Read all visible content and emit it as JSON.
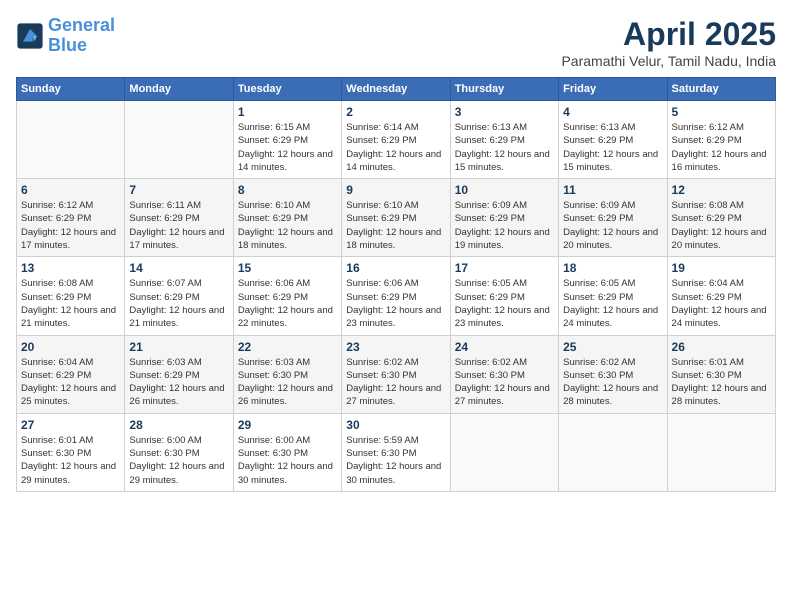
{
  "logo": {
    "line1": "General",
    "line2": "Blue"
  },
  "title": "April 2025",
  "subtitle": "Paramathi Velur, Tamil Nadu, India",
  "headers": [
    "Sunday",
    "Monday",
    "Tuesday",
    "Wednesday",
    "Thursday",
    "Friday",
    "Saturday"
  ],
  "weeks": [
    [
      {
        "day": "",
        "info": ""
      },
      {
        "day": "",
        "info": ""
      },
      {
        "day": "1",
        "info": "Sunrise: 6:15 AM\nSunset: 6:29 PM\nDaylight: 12 hours and 14 minutes."
      },
      {
        "day": "2",
        "info": "Sunrise: 6:14 AM\nSunset: 6:29 PM\nDaylight: 12 hours and 14 minutes."
      },
      {
        "day": "3",
        "info": "Sunrise: 6:13 AM\nSunset: 6:29 PM\nDaylight: 12 hours and 15 minutes."
      },
      {
        "day": "4",
        "info": "Sunrise: 6:13 AM\nSunset: 6:29 PM\nDaylight: 12 hours and 15 minutes."
      },
      {
        "day": "5",
        "info": "Sunrise: 6:12 AM\nSunset: 6:29 PM\nDaylight: 12 hours and 16 minutes."
      }
    ],
    [
      {
        "day": "6",
        "info": "Sunrise: 6:12 AM\nSunset: 6:29 PM\nDaylight: 12 hours and 17 minutes."
      },
      {
        "day": "7",
        "info": "Sunrise: 6:11 AM\nSunset: 6:29 PM\nDaylight: 12 hours and 17 minutes."
      },
      {
        "day": "8",
        "info": "Sunrise: 6:10 AM\nSunset: 6:29 PM\nDaylight: 12 hours and 18 minutes."
      },
      {
        "day": "9",
        "info": "Sunrise: 6:10 AM\nSunset: 6:29 PM\nDaylight: 12 hours and 18 minutes."
      },
      {
        "day": "10",
        "info": "Sunrise: 6:09 AM\nSunset: 6:29 PM\nDaylight: 12 hours and 19 minutes."
      },
      {
        "day": "11",
        "info": "Sunrise: 6:09 AM\nSunset: 6:29 PM\nDaylight: 12 hours and 20 minutes."
      },
      {
        "day": "12",
        "info": "Sunrise: 6:08 AM\nSunset: 6:29 PM\nDaylight: 12 hours and 20 minutes."
      }
    ],
    [
      {
        "day": "13",
        "info": "Sunrise: 6:08 AM\nSunset: 6:29 PM\nDaylight: 12 hours and 21 minutes."
      },
      {
        "day": "14",
        "info": "Sunrise: 6:07 AM\nSunset: 6:29 PM\nDaylight: 12 hours and 21 minutes."
      },
      {
        "day": "15",
        "info": "Sunrise: 6:06 AM\nSunset: 6:29 PM\nDaylight: 12 hours and 22 minutes."
      },
      {
        "day": "16",
        "info": "Sunrise: 6:06 AM\nSunset: 6:29 PM\nDaylight: 12 hours and 23 minutes."
      },
      {
        "day": "17",
        "info": "Sunrise: 6:05 AM\nSunset: 6:29 PM\nDaylight: 12 hours and 23 minutes."
      },
      {
        "day": "18",
        "info": "Sunrise: 6:05 AM\nSunset: 6:29 PM\nDaylight: 12 hours and 24 minutes."
      },
      {
        "day": "19",
        "info": "Sunrise: 6:04 AM\nSunset: 6:29 PM\nDaylight: 12 hours and 24 minutes."
      }
    ],
    [
      {
        "day": "20",
        "info": "Sunrise: 6:04 AM\nSunset: 6:29 PM\nDaylight: 12 hours and 25 minutes."
      },
      {
        "day": "21",
        "info": "Sunrise: 6:03 AM\nSunset: 6:29 PM\nDaylight: 12 hours and 26 minutes."
      },
      {
        "day": "22",
        "info": "Sunrise: 6:03 AM\nSunset: 6:30 PM\nDaylight: 12 hours and 26 minutes."
      },
      {
        "day": "23",
        "info": "Sunrise: 6:02 AM\nSunset: 6:30 PM\nDaylight: 12 hours and 27 minutes."
      },
      {
        "day": "24",
        "info": "Sunrise: 6:02 AM\nSunset: 6:30 PM\nDaylight: 12 hours and 27 minutes."
      },
      {
        "day": "25",
        "info": "Sunrise: 6:02 AM\nSunset: 6:30 PM\nDaylight: 12 hours and 28 minutes."
      },
      {
        "day": "26",
        "info": "Sunrise: 6:01 AM\nSunset: 6:30 PM\nDaylight: 12 hours and 28 minutes."
      }
    ],
    [
      {
        "day": "27",
        "info": "Sunrise: 6:01 AM\nSunset: 6:30 PM\nDaylight: 12 hours and 29 minutes."
      },
      {
        "day": "28",
        "info": "Sunrise: 6:00 AM\nSunset: 6:30 PM\nDaylight: 12 hours and 29 minutes."
      },
      {
        "day": "29",
        "info": "Sunrise: 6:00 AM\nSunset: 6:30 PM\nDaylight: 12 hours and 30 minutes."
      },
      {
        "day": "30",
        "info": "Sunrise: 5:59 AM\nSunset: 6:30 PM\nDaylight: 12 hours and 30 minutes."
      },
      {
        "day": "",
        "info": ""
      },
      {
        "day": "",
        "info": ""
      },
      {
        "day": "",
        "info": ""
      }
    ]
  ]
}
